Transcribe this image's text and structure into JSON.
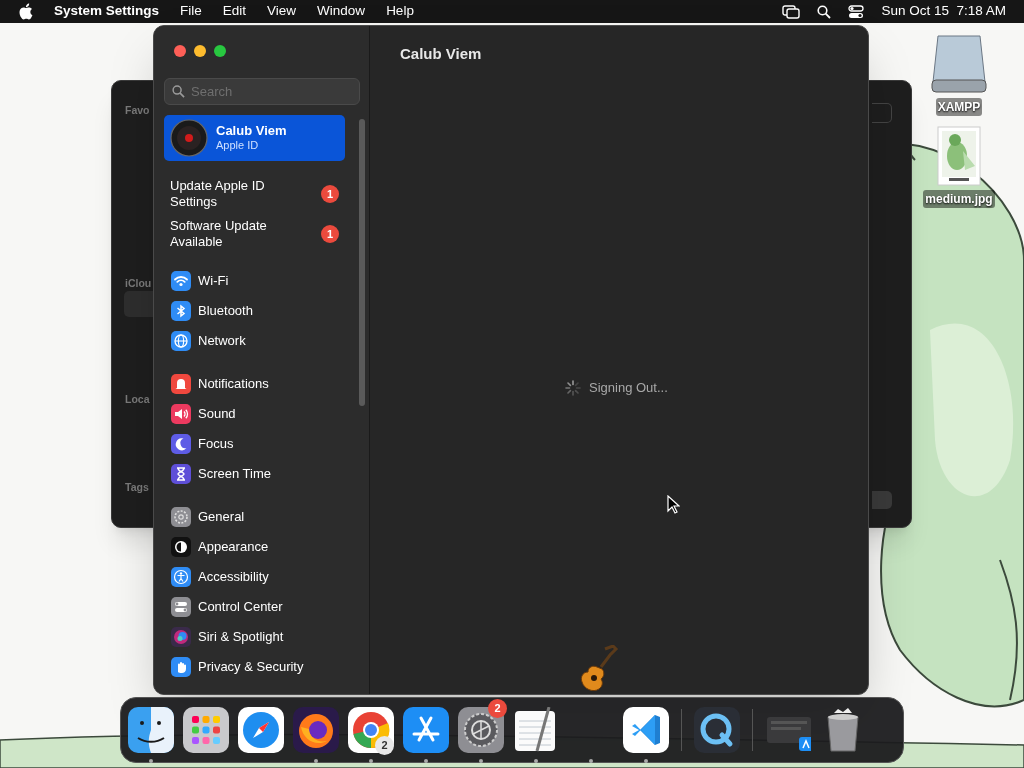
{
  "menu_bar": {
    "app_name": "System Settings",
    "menus": [
      "File",
      "Edit",
      "View",
      "Window",
      "Help"
    ],
    "clock": "Sun Oct 15  7:18 AM"
  },
  "desktop_icons": [
    {
      "label": "XAMPP",
      "kind": "drive"
    },
    {
      "label": "medium.jpg"
    }
  ],
  "background_window": {
    "sidebar_labels": [
      "Favo",
      "iClou",
      "Loca",
      "Tags"
    ]
  },
  "settings": {
    "search": {
      "placeholder": "Search"
    },
    "account": {
      "name": "Calub Viem",
      "subtitle": "Apple ID",
      "selected": true
    },
    "notices": [
      {
        "label": "Update Apple ID Settings",
        "badge": "1"
      },
      {
        "label": "Software Update Available",
        "badge": "1"
      }
    ],
    "groups": [
      [
        {
          "label": "Wi-Fi",
          "kind": "wifi",
          "selected": false
        },
        {
          "label": "Bluetooth",
          "kind": "bluetooth",
          "selected": false
        },
        {
          "label": "Network",
          "kind": "network",
          "selected": false
        }
      ],
      [
        {
          "label": "Notifications",
          "kind": "notifications",
          "selected": false
        },
        {
          "label": "Sound",
          "kind": "sound",
          "selected": false
        },
        {
          "label": "Focus",
          "kind": "focus",
          "selected": false
        },
        {
          "label": "Screen Time",
          "kind": "screentime",
          "selected": false
        }
      ],
      [
        {
          "label": "General",
          "kind": "general",
          "selected": false
        },
        {
          "label": "Appearance",
          "kind": "appearance",
          "selected": false
        },
        {
          "label": "Accessibility",
          "kind": "accessibility",
          "selected": false
        },
        {
          "label": "Control Center",
          "kind": "controlcenter",
          "selected": false
        },
        {
          "label": "Siri & Spotlight",
          "kind": "siri",
          "selected": false
        },
        {
          "label": "Privacy & Security",
          "kind": "privacy",
          "selected": false
        }
      ]
    ],
    "content": {
      "title": "Calub Viem",
      "status": "Signing Out..."
    }
  },
  "dragged_icon": {
    "kind": "guitar"
  },
  "dock": [
    {
      "kind": "finder",
      "running": true
    },
    {
      "kind": "launchpad",
      "running": false
    },
    {
      "kind": "safari",
      "running": false
    },
    {
      "kind": "firefox",
      "running": true
    },
    {
      "kind": "chrome",
      "running": true,
      "badge": "2"
    },
    {
      "kind": "appstore",
      "running": true
    },
    {
      "kind": "settings",
      "running": true,
      "badge": "2"
    },
    {
      "kind": "textedit",
      "running": true
    },
    {
      "kind": "empty",
      "running": true
    },
    {
      "kind": "vscode",
      "running": true
    },
    {
      "kind": "separator"
    },
    {
      "kind": "quicktime",
      "running": false
    },
    {
      "kind": "separator"
    },
    {
      "kind": "downloads",
      "running": false
    },
    {
      "kind": "trash",
      "running": false
    }
  ]
}
